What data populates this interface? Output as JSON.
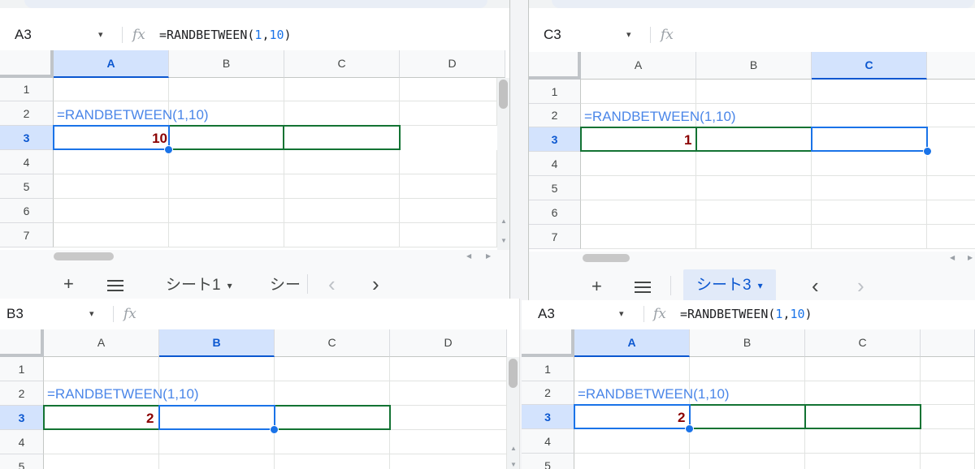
{
  "panes": [
    {
      "id": "top-left",
      "name_box": "A3",
      "formula_bar": {
        "prefix": "=RANDBETWEEN(",
        "arg1": "1",
        "sep": ",",
        "arg2": "10",
        "suffix": ")"
      },
      "columns": [
        "A",
        "B",
        "C",
        "D"
      ],
      "selected_col": "A",
      "rows": [
        "1",
        "2",
        "3",
        "4",
        "5",
        "6",
        "7"
      ],
      "selected_row": "3",
      "formula_text": "=RANDBETWEEN(1,10)",
      "result_value": "10",
      "tabs": {
        "add": "+",
        "active_sheet": "シート1",
        "next_sheet": "シー",
        "prev": "‹",
        "next": "›"
      }
    },
    {
      "id": "top-right",
      "name_box": "C3",
      "formula_bar": {
        "prefix": "",
        "arg1": "",
        "sep": "",
        "arg2": "",
        "suffix": ""
      },
      "columns": [
        "A",
        "B",
        "C"
      ],
      "selected_col": "C",
      "rows": [
        "1",
        "2",
        "3",
        "4",
        "5",
        "6",
        "7"
      ],
      "selected_row": "3",
      "formula_text": "=RANDBETWEEN(1,10)",
      "result_value": "1",
      "tabs": {
        "add": "+",
        "active_sheet": "シート3",
        "prev": "‹",
        "next": "›"
      }
    },
    {
      "id": "bottom-left",
      "name_box": "B3",
      "formula_bar": {
        "prefix": "",
        "arg1": "",
        "sep": "",
        "arg2": "",
        "suffix": ""
      },
      "columns": [
        "A",
        "B",
        "C",
        "D"
      ],
      "selected_col": "B",
      "rows": [
        "1",
        "2",
        "3",
        "4",
        "5"
      ],
      "selected_row": "3",
      "formula_text": "=RANDBETWEEN(1,10)",
      "result_value": "2"
    },
    {
      "id": "bottom-right",
      "name_box": "A3",
      "formula_bar": {
        "prefix": "=RANDBETWEEN(",
        "arg1": "1",
        "sep": ",",
        "arg2": "10",
        "suffix": ")"
      },
      "columns": [
        "A",
        "B",
        "C"
      ],
      "selected_col": "A",
      "rows": [
        "1",
        "2",
        "3",
        "4",
        "5"
      ],
      "selected_row": "3",
      "formula_text": "=RANDBETWEEN(1,10)",
      "result_value": "2"
    }
  ],
  "icons": {
    "fx": "fx",
    "caret": "▾",
    "scroll_up": "▲",
    "scroll_down": "▼",
    "scroll_left": "◀",
    "scroll_right": "▶"
  },
  "colors": {
    "formula": "#4a86e8",
    "result": "#8b0000",
    "selection_blue": "#1a73e8",
    "range_green": "#137333",
    "header_selected": "#d3e3fd"
  }
}
